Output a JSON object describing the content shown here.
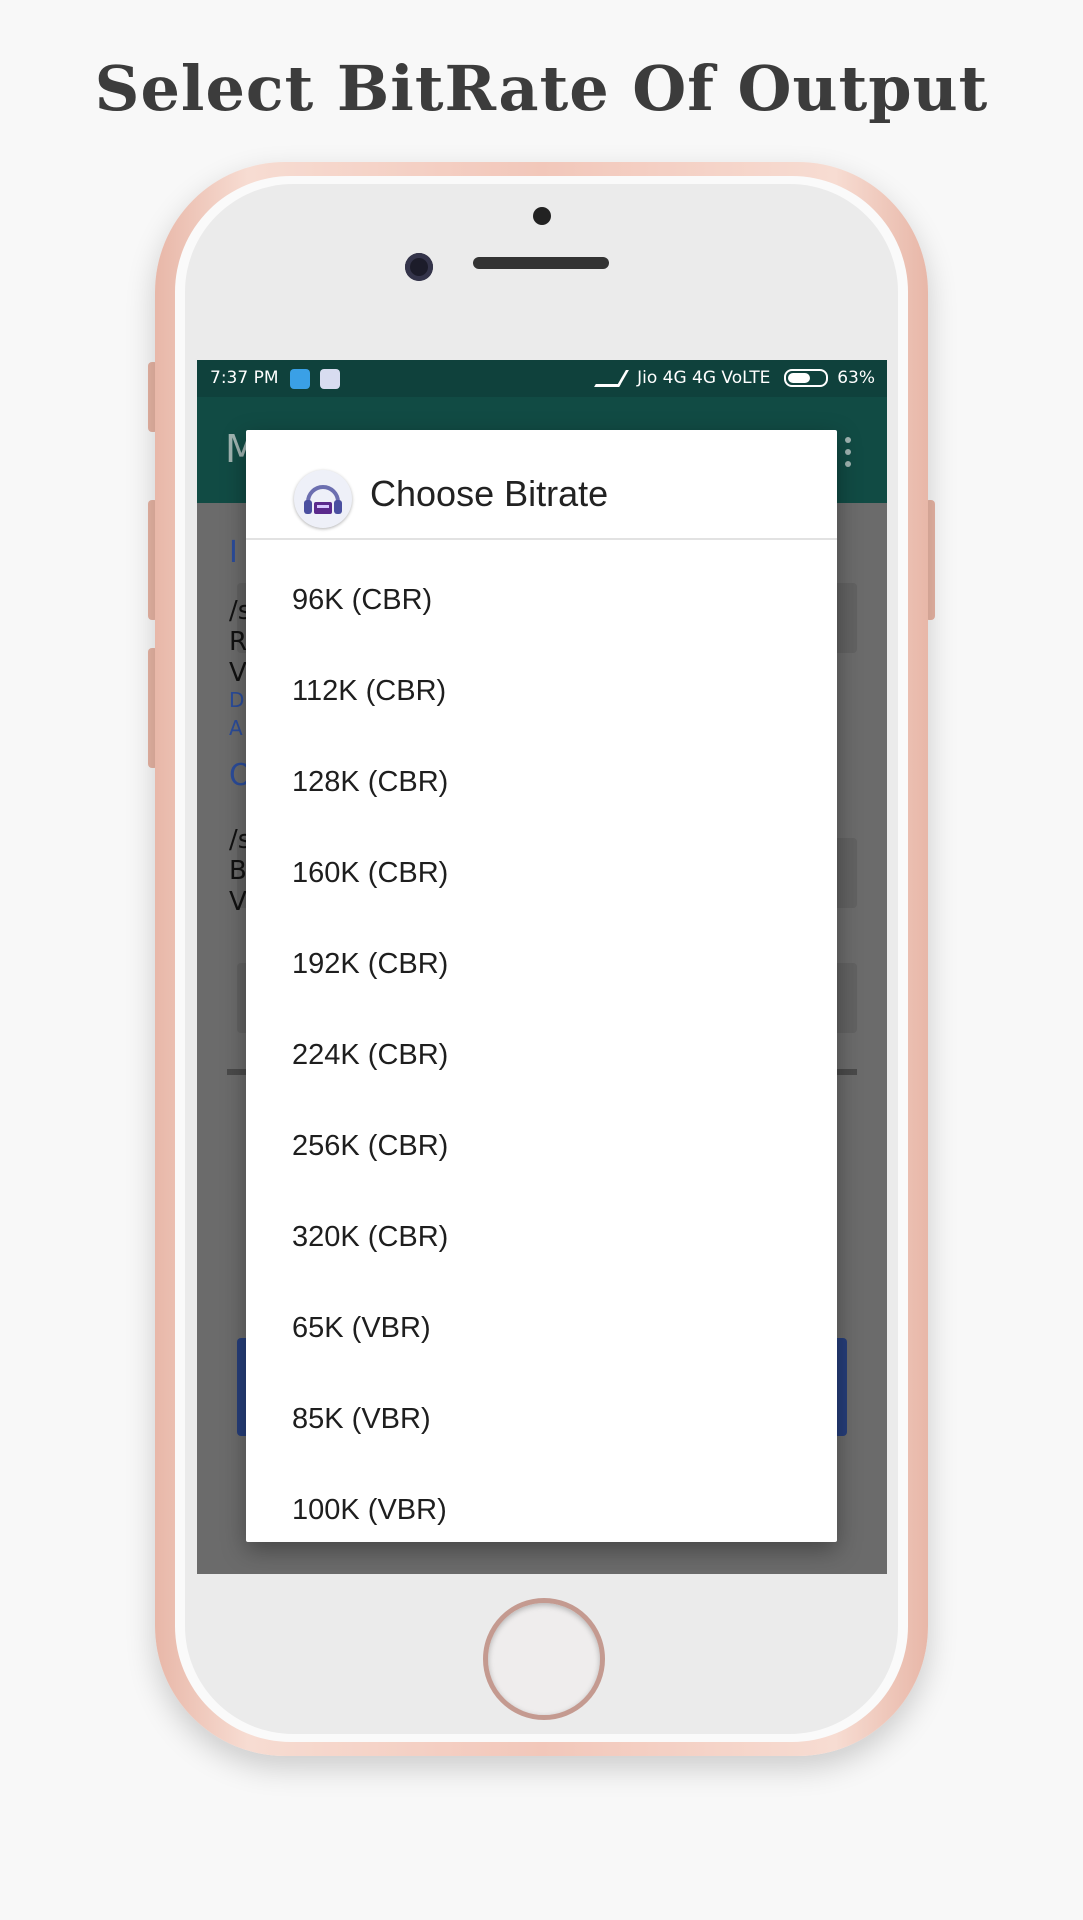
{
  "headline": "Select BitRate Of Output",
  "status_bar": {
    "time": "7:37 PM",
    "network": "Jio 4G 4G VoLTE",
    "battery": "63%"
  },
  "toolbar": {
    "title_partial": "M"
  },
  "background": {
    "input_heading_partial": "I",
    "input_lines": [
      "/s",
      "R",
      "V"
    ],
    "input_links": [
      "D",
      "A"
    ],
    "output_heading_partial": "O",
    "output_lines": [
      "/s",
      "B",
      "V"
    ]
  },
  "dialog": {
    "title": "Choose Bitrate",
    "icon": "music-converter-app-icon",
    "items": [
      "96K (CBR)",
      "112K (CBR)",
      "128K (CBR)",
      "160K (CBR)",
      "192K (CBR)",
      "224K (CBR)",
      "256K (CBR)",
      "320K (CBR)",
      "65K (VBR)",
      "85K (VBR)",
      "100K (VBR)"
    ]
  },
  "colors": {
    "status_bar": "#0f413c",
    "toolbar": "#114b44",
    "scrim": "#6b6b6b",
    "phone_frame": "#f2c7ba"
  }
}
